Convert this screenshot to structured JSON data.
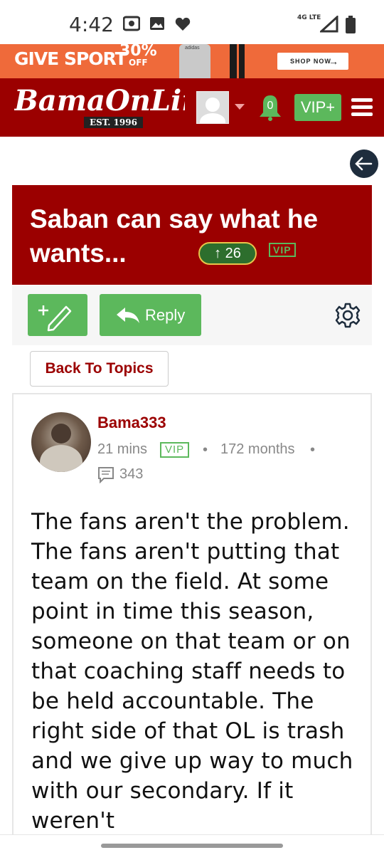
{
  "status": {
    "time": "4:42",
    "network": "4G LTE"
  },
  "ad": {
    "headline": "GIVE SPORT",
    "percent": "30%",
    "percent_sub": "OFF",
    "product": "adidas",
    "cta": "SHOP NOW"
  },
  "header": {
    "logo": "BamaOnLine",
    "est": "EST. 1996",
    "notifications": "0",
    "vip": "VIP+"
  },
  "thread": {
    "title": "Saban can say what he wants...",
    "votes": "26",
    "vip_tag": "VIP",
    "reply_label": "Reply",
    "back_label": "Back To Topics"
  },
  "post": {
    "author": "Bama333",
    "time": "21 mins",
    "vip_tag": "VIP",
    "membership": "172 months",
    "message_count": "343",
    "body": "The fans aren't the problem. The fans aren't putting that team on the field. At some point in time this season, someone on that team or on that coaching staff needs to be held accountable. The right side of that OL is trash and we give up way to much with our secondary. If it weren't"
  },
  "colors": {
    "brand": "#9b0000",
    "green": "#5cb85c",
    "dark": "#1e2d3d"
  },
  "icons": [
    "camera-icon",
    "image-icon",
    "heart-icon",
    "signal-icon",
    "battery-icon",
    "bell-icon",
    "menu-icon",
    "back-arrow-icon",
    "edit-icon",
    "reply-icon",
    "gear-icon",
    "message-icon"
  ]
}
